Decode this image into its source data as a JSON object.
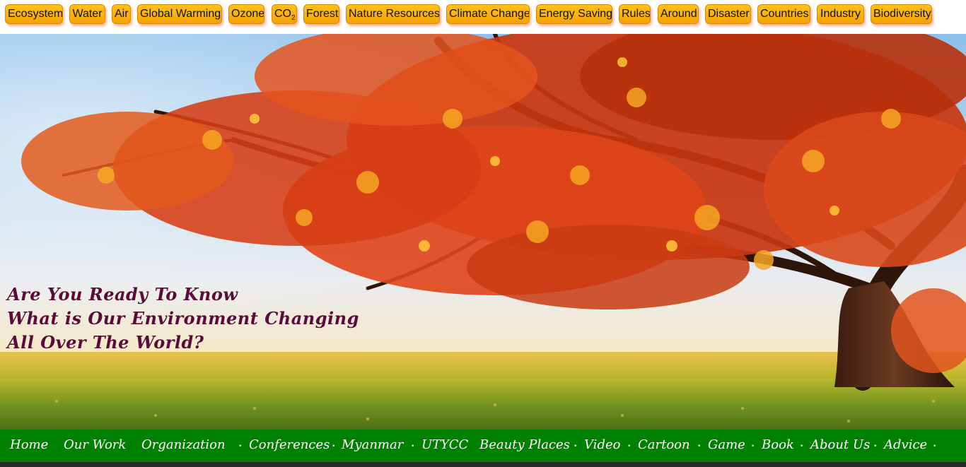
{
  "categories": [
    {
      "label": "Ecosystem"
    },
    {
      "label": "Water"
    },
    {
      "label": "Air"
    },
    {
      "label": "Global Warming"
    },
    {
      "label": "Ozone"
    },
    {
      "label": "CO",
      "subscript": "2"
    },
    {
      "label": "Forest"
    },
    {
      "label": "Nature Resources"
    },
    {
      "label": "Climate Change"
    },
    {
      "label": "Energy Saving"
    },
    {
      "label": "Rules"
    },
    {
      "label": "Around"
    },
    {
      "label": "Disaster"
    },
    {
      "label": "Countries"
    },
    {
      "label": "Industry"
    },
    {
      "label": "Biodiversity"
    }
  ],
  "hero": {
    "tagline": [
      "Are You Ready To Know",
      "What is Our Environment Changing",
      "All Over The World?"
    ],
    "colors": {
      "tagline": "#5a0b3a",
      "foliage": "#e0451a",
      "grass": "#7a9a1e"
    }
  },
  "nav": {
    "items": [
      "Home",
      "Our Work",
      "Organization",
      "Conferences",
      "Myanmar",
      "UTYCC",
      "Beauty Places",
      "Video",
      "Cartoon",
      "Game",
      "Book",
      "About Us",
      "Advice"
    ],
    "separator": "•",
    "colors": {
      "background": "#008000",
      "text": "#ffffff"
    }
  },
  "colors": {
    "button": "#f5a300",
    "button_shadow": "#ff7a3c"
  }
}
